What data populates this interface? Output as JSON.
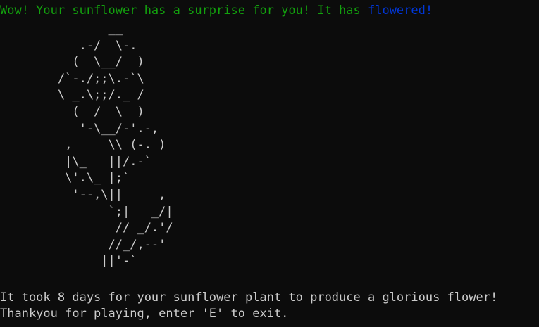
{
  "terminal": {
    "header_prefix": "Wow! Your sunflower has a surprise for you! It has ",
    "header_highlight": "flowered!",
    "ascii_art": "               __\n           .-/  \\-.\n          (  \\__/  )\n        /`-./;;\\.-`\\\n        \\ _.\\;;/._ /\n          (  /  \\  )\n           '-\\__/-'.-,\n         ,     \\\\ (-. )\n         |\\_   ||/.-`\n         \\'.\\_ |;`\n          '--,\\||     ,\n               `;|   _/|\n                // _/.'/\n               //_/,--'\n              ||'-`",
    "message_line1": "It took 8 days for your sunflower plant to produce a glorious flower!",
    "message_line2": "Thankyou for playing, enter 'E' to exit."
  },
  "colors": {
    "background": "#0c0c0c",
    "text": "#cccccc",
    "header_green": "#13a10e",
    "highlight_blue": "#0037da"
  }
}
